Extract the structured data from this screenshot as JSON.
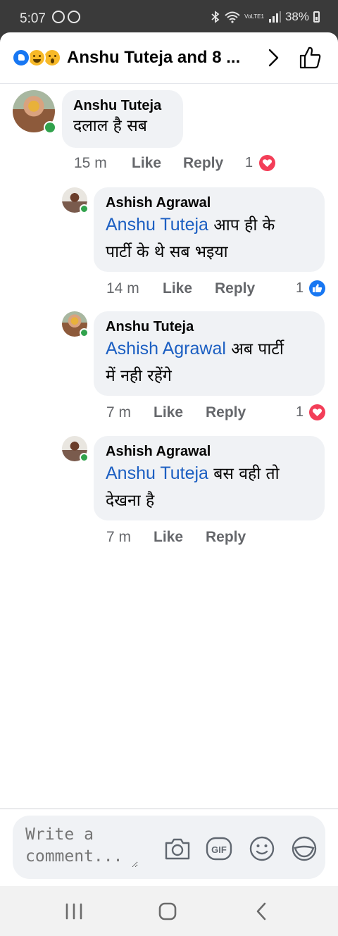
{
  "status_bar": {
    "time": "5:07",
    "network": "VoLTE1",
    "battery": "38%"
  },
  "header": {
    "reaction_icons": [
      "like-icon",
      "laugh-icon",
      "wow-icon"
    ],
    "title": "Anshu Tuteja and 8 ..."
  },
  "comments": [
    {
      "author": "Anshu Tuteja",
      "mention": "",
      "text": "दलाल है सब",
      "text_line2": "",
      "time": "15 m",
      "like_label": "Like",
      "reply_label": "Reply",
      "reaction_count": "1",
      "reaction_icon": "love-icon"
    },
    {
      "author": "Ashish Agrawal",
      "mention": "Anshu Tuteja",
      "text": " आप ही के",
      "text_line2": "पार्टी के थे सब भइया",
      "time": "14 m",
      "like_label": "Like",
      "reply_label": "Reply",
      "reaction_count": "1",
      "reaction_icon": "like-icon"
    },
    {
      "author": "Anshu Tuteja",
      "mention": "Ashish Agrawal",
      "text": " अब पार्टी",
      "text_line2": "में नही रहेंगे",
      "time": "7 m",
      "like_label": "Like",
      "reply_label": "Reply",
      "reaction_count": "1",
      "reaction_icon": "love-icon"
    },
    {
      "author": "Ashish Agrawal",
      "mention": "Anshu Tuteja",
      "text": " बस वही तो",
      "text_line2": "देखना है",
      "time": "7 m",
      "like_label": "Like",
      "reply_label": "Reply",
      "reaction_count": "",
      "reaction_icon": ""
    }
  ],
  "composer": {
    "placeholder": "Write a comment...",
    "icons": [
      "camera-icon",
      "gif-icon",
      "emoji-icon",
      "sticker-icon"
    ]
  },
  "navigation": {
    "buttons": [
      "recent-apps-icon",
      "home-icon",
      "back-icon"
    ]
  },
  "colors": {
    "mention": "#1c5fc2",
    "bubble": "#f0f2f5",
    "love": "#f33e58",
    "like": "#1877f2",
    "online": "#31a24c"
  }
}
